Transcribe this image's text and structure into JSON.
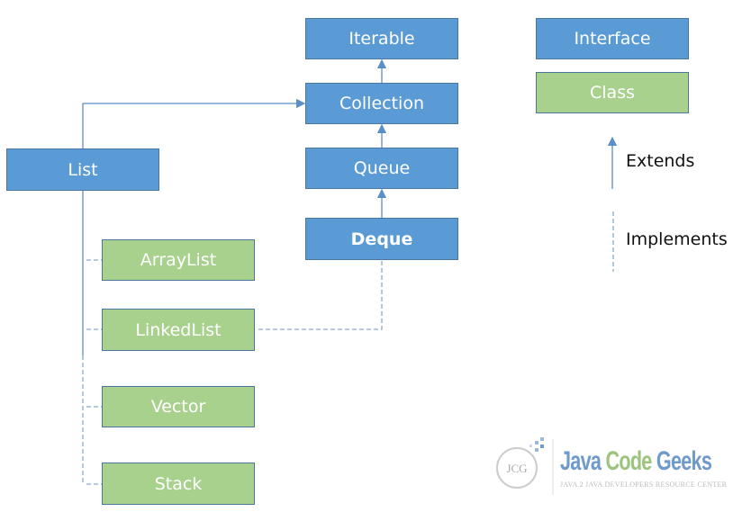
{
  "colors": {
    "interface": "#5b9bd5",
    "class": "#a9d18e",
    "line": "#5b8fc7",
    "border": "#4a76a0"
  },
  "nodes": {
    "iterable": "Iterable",
    "collection": "Collection",
    "queue": "Queue",
    "deque": "Deque",
    "list": "List",
    "arraylist": "ArrayList",
    "linkedlist": "LinkedList",
    "vector": "Vector",
    "stack": "Stack"
  },
  "legend": {
    "interface": "Interface",
    "class": "Class",
    "extends": "Extends",
    "implements": "Implements"
  },
  "logo": {
    "word1": "Java",
    "word2": "Code",
    "word3": "Geeks",
    "tagline": "JAVA 2 JAVA DEVELOPERS RESOURCE CENTER",
    "mark": "JCG"
  }
}
